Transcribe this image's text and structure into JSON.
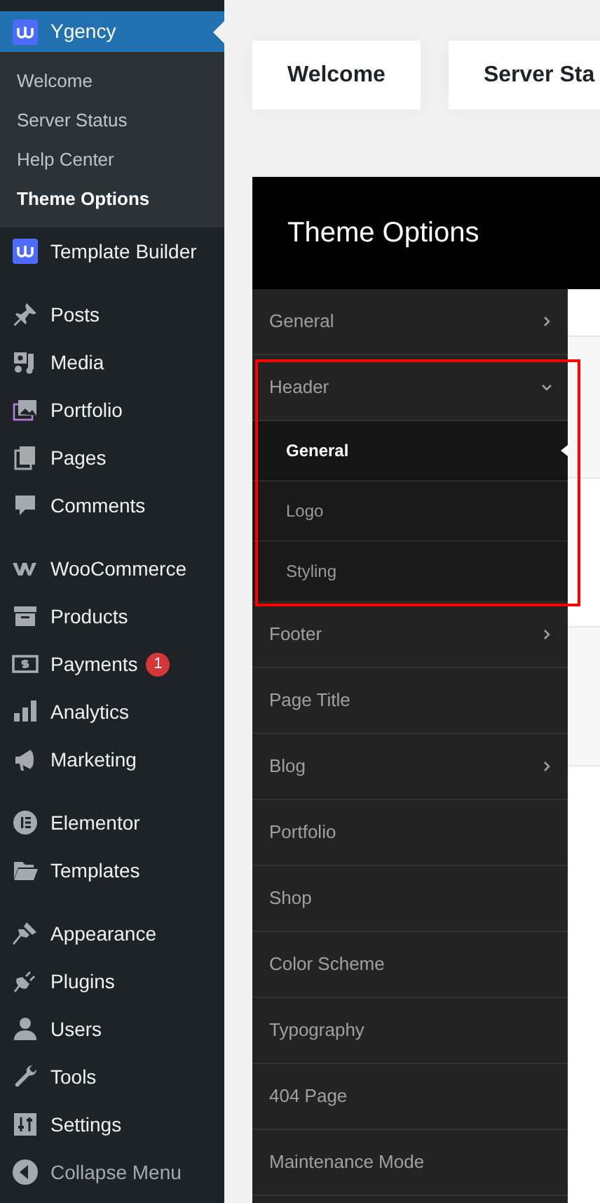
{
  "sidebar": {
    "groups": [
      {
        "items": [
          {
            "label": "Ygency",
            "selected": true,
            "submenu": [
              {
                "label": "Welcome",
                "selected": false
              },
              {
                "label": "Server Status",
                "selected": false
              },
              {
                "label": "Help Center",
                "selected": false
              },
              {
                "label": "Theme Options",
                "selected": true
              }
            ]
          },
          {
            "label": "Template Builder",
            "selected": false
          }
        ]
      },
      {
        "items": [
          {
            "label": "Posts",
            "selected": false
          },
          {
            "label": "Media",
            "selected": false
          },
          {
            "label": "Portfolio",
            "selected": false
          },
          {
            "label": "Pages",
            "selected": false
          },
          {
            "label": "Comments",
            "selected": false
          }
        ]
      },
      {
        "items": [
          {
            "label": "WooCommerce",
            "selected": false
          },
          {
            "label": "Products",
            "selected": false
          },
          {
            "label": "Payments",
            "selected": false,
            "badge": "1"
          },
          {
            "label": "Analytics",
            "selected": false
          },
          {
            "label": "Marketing",
            "selected": false
          }
        ]
      },
      {
        "items": [
          {
            "label": "Elementor",
            "selected": false
          },
          {
            "label": "Templates",
            "selected": false
          }
        ]
      },
      {
        "items": [
          {
            "label": "Appearance",
            "selected": false
          },
          {
            "label": "Plugins",
            "selected": false
          },
          {
            "label": "Users",
            "selected": false
          },
          {
            "label": "Tools",
            "selected": false
          },
          {
            "label": "Settings",
            "selected": false
          }
        ]
      }
    ],
    "collapse": "Collapse Menu"
  },
  "tabs": [
    {
      "label": "Welcome",
      "selected": false
    },
    {
      "label": "Server Sta",
      "selected": false
    }
  ],
  "panel": {
    "title": "Theme Options",
    "menu": [
      {
        "label": "General",
        "selected": false,
        "expanded": false
      },
      {
        "label": "Header",
        "selected": false,
        "expanded": true,
        "highlighted": true,
        "children": [
          {
            "label": "General",
            "selected": true
          },
          {
            "label": "Logo",
            "selected": false
          },
          {
            "label": "Styling",
            "selected": false
          }
        ]
      },
      {
        "label": "Footer",
        "selected": false,
        "expanded": false
      },
      {
        "label": "Page Title",
        "selected": false
      },
      {
        "label": "Blog",
        "selected": false,
        "expanded": false
      },
      {
        "label": "Portfolio",
        "selected": false
      },
      {
        "label": "Shop",
        "selected": false
      },
      {
        "label": "Color Scheme",
        "selected": false
      },
      {
        "label": "Typography",
        "selected": false
      },
      {
        "label": "404 Page",
        "selected": false
      },
      {
        "label": "Maintenance Mode",
        "selected": false
      }
    ]
  }
}
